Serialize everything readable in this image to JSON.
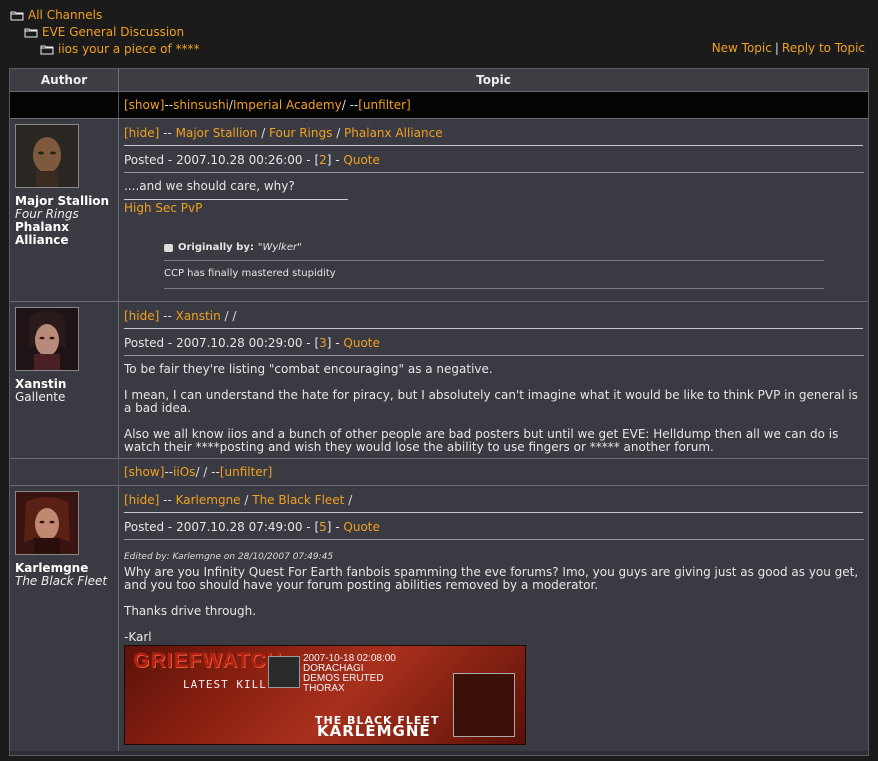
{
  "breadcrumbs": [
    {
      "label": "All Channels"
    },
    {
      "label": "EVE General Discussion"
    },
    {
      "label": "iios your a piece of ****"
    }
  ],
  "toplinks": {
    "new_topic": "New Topic",
    "separator": "|",
    "reply": "Reply to Topic"
  },
  "table": {
    "author_header": "Author",
    "topic_header": "Topic"
  },
  "filter1": {
    "show": "[show]",
    "sep1": " -- ",
    "name": "shinsushi",
    "slash1": " / ",
    "corp": "Imperial Academy",
    "tail": " / -- ",
    "unfilter": "[unfilter]"
  },
  "filter2": {
    "show": "[show]",
    "sep1": " -- ",
    "name": "iiOs",
    "tail": " / / -- ",
    "unfilter": "[unfilter]"
  },
  "posts": [
    {
      "author": {
        "name": "Major Stallion",
        "corp": "Four Rings",
        "alliance": "Phalanx Alliance"
      },
      "head": {
        "hide": "[hide]",
        "dash": " -- ",
        "name": "Major Stallion",
        "slash1": " / ",
        "corp": "Four Rings",
        "slash2": " / ",
        "alliance": "Phalanx Alliance"
      },
      "meta": {
        "posted": "Posted - 2007.10.28 00:26:00 - [",
        "num": "2",
        "close": "] - ",
        "quote": "Quote"
      },
      "body": [
        "....and we should care, why?"
      ],
      "signature": "High Sec PvP",
      "quote": {
        "label": "Originally by:",
        "who": "\"Wylker\"",
        "text": "CCP has finally mastered stupidity"
      }
    },
    {
      "author": {
        "name": "Xanstin",
        "corp": "Gallente"
      },
      "head": {
        "hide": "[hide]",
        "dash": " -- ",
        "name": "Xanstin",
        "tail": " / /"
      },
      "meta": {
        "posted": "Posted - 2007.10.28 00:29:00 - [",
        "num": "3",
        "close": "] - ",
        "quote": "Quote"
      },
      "body": [
        "To be fair they're listing \"combat encouraging\" as a negative.",
        "I mean, I can understand the hate for piracy, but I absolutely can't imagine what it would be like to think PVP in general is a bad idea.",
        "Also we all know iios and a bunch of other people are bad posters but until we get EVE: Helldump then all we can do is watch their ****posting and wish they would lose the ability to use fingers or ***** another forum."
      ]
    },
    {
      "author": {
        "name": "Karlemgne",
        "corp": "The Black Fleet"
      },
      "head": {
        "hide": "[hide]",
        "dash": " -- ",
        "name": "Karlemgne",
        "slash1": " / ",
        "corp": "The Black Fleet",
        "tail": " /"
      },
      "meta": {
        "posted": "Posted - 2007.10.28 07:49:00 - [",
        "num": "5",
        "close": "] - ",
        "quote": "Quote"
      },
      "edited": "Edited by: Karlemgne on 28/10/2007 07:49:45",
      "body": [
        "Why are you Infinity Quest For Earth fanbois spamming the eve forums? Imo, you guys are giving just as good as you get, and you too should have your forum posting abilities removed by a moderator.",
        "Thanks drive through.",
        "-Karl"
      ],
      "banner": {
        "title": "GRIEFWATCH",
        "subtitle": "LATEST KILL",
        "date": "2007-10-18 02:08:00",
        "line1": "DORACHAGI",
        "line2": "DEMOS ERUTED",
        "line3": "THORAX",
        "fleet": "THE BLACK FLEET",
        "name": "KARLEMGNE"
      }
    }
  ],
  "colors": {
    "link": "#f0a020",
    "post_bg": "#3a3a42",
    "filter_bg": "#050505",
    "header_bg": "#3d3d44"
  }
}
